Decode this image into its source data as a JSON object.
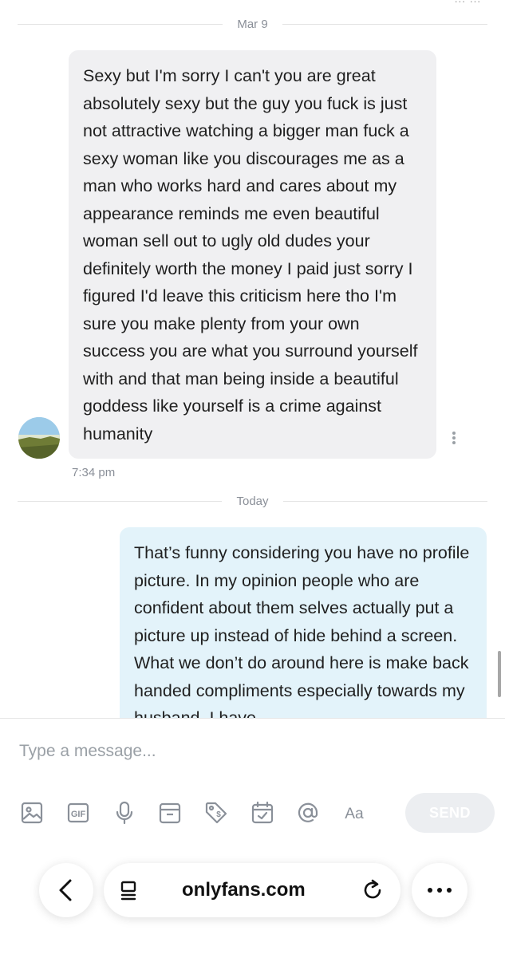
{
  "chat": {
    "top_fragment": "… …",
    "dividers": {
      "first": "Mar 9",
      "second": "Today"
    },
    "incoming": {
      "text": "Sexy but I'm sorry I can't you are great absolutely sexy but the guy you fuck is just not attractive watching a bigger man fuck a sexy woman like you discourages me as a man who works hard and cares about my appearance reminds me even beautiful woman sell out to ugly old dudes your definitely worth the money I paid just sorry I figured I'd leave this criticism here tho I'm sure you make plenty from your own success you are what you surround yourself with and that man being inside a beautiful goddess like yourself is a crime against humanity",
      "time": "7:34 pm"
    },
    "outgoing": {
      "text": "That’s funny considering you have no profile picture. In my opinion people who are confident about them selves actually put a picture up instead of hide behind a screen. What we don’t do around here is make back handed compliments especially towards my husband. I have"
    }
  },
  "composer": {
    "placeholder": "Type a message...",
    "tools": [
      "image-icon",
      "gif-icon",
      "microphone-icon",
      "vault-icon",
      "price-tag-icon",
      "calendar-icon",
      "mention-icon",
      "text-format-icon"
    ],
    "gif_label": "GIF",
    "text_format_label": "Aa",
    "send_label": "SEND"
  },
  "browser": {
    "url": "onlyfans.com"
  },
  "colors": {
    "incoming_bubble": "#f0f0f2",
    "outgoing_bubble": "#e3f3fa",
    "icon_gray": "#8a9099"
  }
}
